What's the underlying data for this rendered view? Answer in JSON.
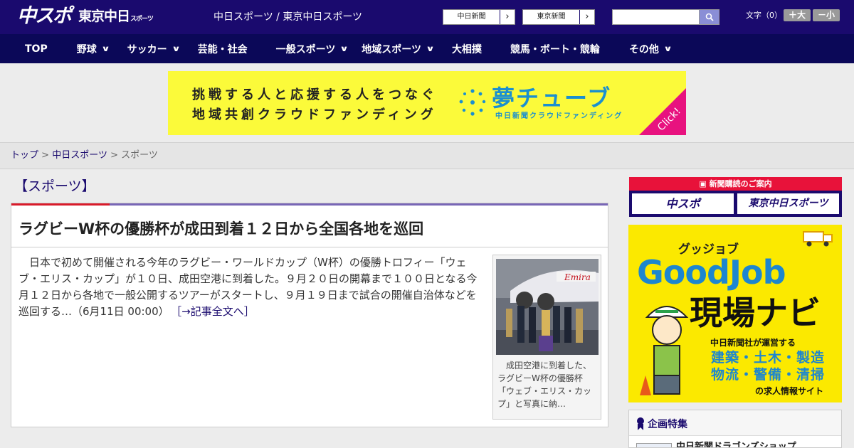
{
  "header": {
    "logo_chuspo": "中スポ",
    "logo_tokyo": "東京中日",
    "logo_tokyo_sub": "スポーツ",
    "site_links": "中日スポーツ / 東京中日スポーツ",
    "paper_buttons": [
      "中日新聞",
      "東京新聞"
    ],
    "search_placeholder": "",
    "font_size_label": "文字（0）",
    "font_larger": "＋大",
    "font_smaller": "－小"
  },
  "nav": {
    "items": [
      {
        "label": "TOP",
        "has_menu": false
      },
      {
        "label": "野球",
        "has_menu": true
      },
      {
        "label": "サッカー",
        "has_menu": true
      },
      {
        "label": "芸能・社会",
        "has_menu": false
      },
      {
        "label": "一般スポーツ",
        "has_menu": true
      },
      {
        "label": "地域スポーツ",
        "has_menu": true
      },
      {
        "label": "大相撲",
        "has_menu": false
      },
      {
        "label": "競馬・ボート・競輪",
        "has_menu": false
      },
      {
        "label": "その他",
        "has_menu": true
      }
    ]
  },
  "banner": {
    "line1": "挑戦する人と応援する人をつなぐ",
    "line2": "地域共創クラウドファンディング",
    "brand": "夢チューブ",
    "brand_sub": "中日新聞クラウドファンディング",
    "click": "Click!"
  },
  "breadcrumb": {
    "home": "トップ",
    "parent": "中日スポーツ",
    "current": "スポーツ",
    "separator": ">"
  },
  "main": {
    "section_title": "【スポーツ】",
    "headline": "ラグビーW杯の優勝杯が成田到着１２日から全国各地を巡回",
    "body": "日本で初めて開催される今年のラグビー・ワールドカップ（W杯）の優勝トロフィー「ウェブ・エリス・カップ」が１０日、成田空港に到着した。９月２０日の開幕まで１００日となる今月１２日から各地で一般公開するツアーがスタートし、９月１９日まで試合の開催自治体などを巡回する…（6月11日 00:00）",
    "read_more": "［→記事全文へ］",
    "caption": "成田空港に到着した、ラグビーW杯の優勝杯「ウェブ・エリス・カップ」と写真に納…"
  },
  "sidebar": {
    "subscribe_head": "新聞購読のご案内",
    "subscribe_buttons": [
      "中スポ",
      "東京中日スポーツ"
    ],
    "job_ad": {
      "kana": "グッジョブ",
      "title": "GoodJob",
      "subtitle": "現場ナビ",
      "operator": "中日新聞社が運営する",
      "industries_1": "建築・土木・製造",
      "industries_2": "物流・警備・清掃",
      "site": "の求人情報サイト"
    },
    "feature_title": "企画特集",
    "feature_item": "中日新聞ドラゴンズショップ"
  },
  "colors": {
    "header_bg": "#1a0a6e",
    "nav_bg": "#0b0858",
    "banner_bg": "#fbfa3a",
    "accent_red": "#d91a2a",
    "job_ad_bg": "#fbe900"
  }
}
